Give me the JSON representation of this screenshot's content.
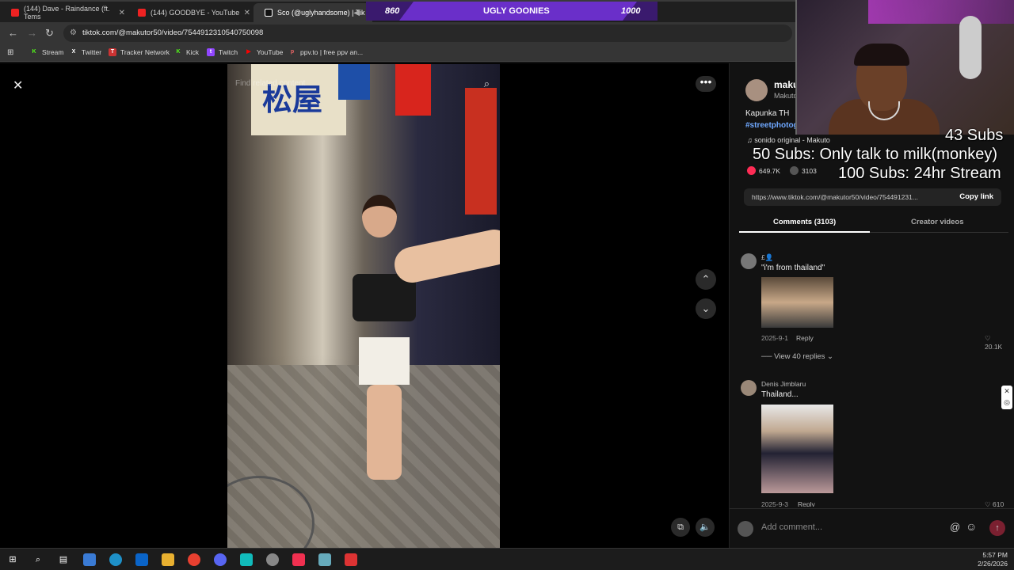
{
  "browser": {
    "tabs": [
      {
        "label": "(144) Dave - Raindance (ft. Tems",
        "color": "#e22"
      },
      {
        "label": "(144) GOODBYE - YouTube",
        "color": "#e22"
      },
      {
        "label": "Sco (@uglyhandsome) | Tik",
        "color": "#fff"
      }
    ],
    "url": "tiktok.com/@makutor50/video/7544912310540750098",
    "bookmarks": [
      {
        "label": "Stream",
        "icon": "K",
        "color": "#53fc18"
      },
      {
        "label": "Twitter",
        "icon": "X",
        "color": "#fff"
      },
      {
        "label": "Tracker Network",
        "icon": "T",
        "color": "#e44"
      },
      {
        "label": "Kick",
        "icon": "K",
        "color": "#53fc18"
      },
      {
        "label": "Twitch",
        "icon": "t",
        "color": "#9146ff"
      },
      {
        "label": "YouTube",
        "icon": "▶",
        "color": "#f00"
      },
      {
        "label": "ppv.to | free ppv an...",
        "icon": "p",
        "color": "#a33"
      }
    ]
  },
  "sub_goal": {
    "left": "860",
    "title": "UGLY GOONIES",
    "right": "1000"
  },
  "video": {
    "search_placeholder": "Find related content",
    "sign_text": "松屋"
  },
  "post": {
    "author": "maku",
    "author_sub": "Makuto",
    "caption": "Kapunka TH",
    "hashtags": "#streetphotography",
    "sound": "sonido original - Makuto",
    "likes": "649.7K",
    "comments": "3103",
    "link": "https://www.tiktok.com/@makutor50/video/754491231...",
    "copy_link": "Copy link"
  },
  "panel_tabs": {
    "comments": "Comments (3103)",
    "creator": "Creator videos"
  },
  "comments": [
    {
      "user": "£👤",
      "text": "\"i'm from thailand\"",
      "date": "2025-9-1",
      "reply": "Reply",
      "likes": "20.1K",
      "replies": "View 40 replies"
    },
    {
      "user": "Denis Jimblaru",
      "text": "Thailand...",
      "date": "2025-9-3",
      "reply": "Reply",
      "likes": "610"
    }
  ],
  "add_comment": {
    "placeholder": "Add comment..."
  },
  "overlay": {
    "line1": "43 Subs",
    "line2": "50 Subs: Only talk to milk(monkey)",
    "line3": "100 Subs: 24hr Stream"
  },
  "taskbar": {
    "time": "5:57 PM",
    "date": "2/26/2026"
  },
  "colors": {
    "accent_purple": "#6a2fc9",
    "tiktok_red": "#fe2c55",
    "link_blue": "#6fa8ff"
  }
}
